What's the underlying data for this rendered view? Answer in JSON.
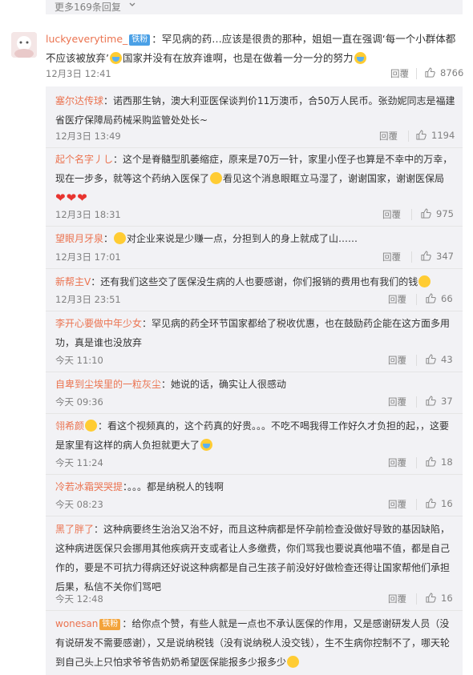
{
  "more_replies_link": "更多169条回复",
  "main_comment": {
    "username": "luckyeverytime_",
    "badge": "铁粉",
    "text_part1": "：罕见病的药…应该是很贵的那种，姐姐一直在强调‘每一个小群体都不应该被放弃’",
    "text_part2": "国家并没有在放弃谁啊，也是在做着一分一分的努力",
    "time": "12月3日 12:41",
    "reply_label": "回覆",
    "likes": "8766"
  },
  "replies": [
    {
      "username": "塞尔达传球",
      "text": "：诺西那生钠，澳大利亚医保谈判价11万澳币，合50万人民币。张劲妮同志是福建省医疗保障局药械采购监管处处长~",
      "time": "12月3日 13:49",
      "reply_label": "回覆",
      "likes": "1194"
    },
    {
      "username": "起个名字丿し",
      "text": "：这个是脊髓型肌萎缩症，原来是70万一针，家里小侄子也算是不幸中的万幸，现在一步多，就等这个药纳入医保了",
      "text2": "看见这个消息眼眶立马湿了，谢谢国家，谢谢医保局",
      "time": "12月3日 18:31",
      "reply_label": "回覆",
      "likes": "975"
    },
    {
      "username": "望眼月牙泉",
      "text": "：",
      "text2": "对企业来说是少赚一点，分担到人的身上就成了山……",
      "time": "12月3日 17:01",
      "reply_label": "回覆",
      "likes": "347"
    },
    {
      "username": "新帮主V",
      "text": "：还有我们这些交了医保没生病的人也要感谢，你们报销的费用也有我们的钱",
      "time": "12月3日 23:51",
      "reply_label": "回覆",
      "likes": "66"
    },
    {
      "username": "李开心要做中年少女",
      "text": "：罕见病的药全环节国家都给了税收优惠，也在鼓励药企能在这方面多用功，真是谁也没放弃",
      "time": "今天 11:10",
      "reply_label": "回覆",
      "likes": "43"
    },
    {
      "username": "自卑到尘埃里的一粒灰尘",
      "text": "：她说的话，确实让人很感动",
      "time": "今天 09:36",
      "reply_label": "回覆",
      "likes": "37"
    },
    {
      "username": "翎希颜",
      "text": "：看这个视频真的，这个药真的好贵。。。不吃不喝我得工作好久才负担的起，，这要是家里有这样的病人负担就更大了",
      "time": "今天 11:24",
      "reply_label": "回覆",
      "likes": "18"
    },
    {
      "username": "冷若冰霜哭哭提",
      "text": "：。。。都是纳税人的钱啊",
      "time": "今天 08:23",
      "reply_label": "回覆",
      "likes": "16"
    },
    {
      "username": "黑了胖了",
      "text": "：这种病要终生治治又治不好，而且这种病都是怀孕前检查没做好导致的基因缺陷，这种病进医保只会挪用其他疾病开支或者让人多缴费，你们骂我也要说真他喵不值，都是自己作的，要是不可抗力得病还好说这种病都是自己生孩子前没好好做检查还得让国家帮他们承担后果，私信不关你们骂吧",
      "time": "今天 12:48",
      "reply_label": "回覆",
      "likes": "16"
    },
    {
      "username": "wonesan",
      "badge": "铁粉",
      "text": "：给你点个赞，有些人就是一点也不承认医保的作用，又是感谢研发人员（没有说研发不需要感谢），又是说纳税钱（没有说纳税人没交钱），生不生病你控制不了，哪天轮到自己头上只怕求爷爷告奶奶希望医保能报多少报多少"
    }
  ]
}
